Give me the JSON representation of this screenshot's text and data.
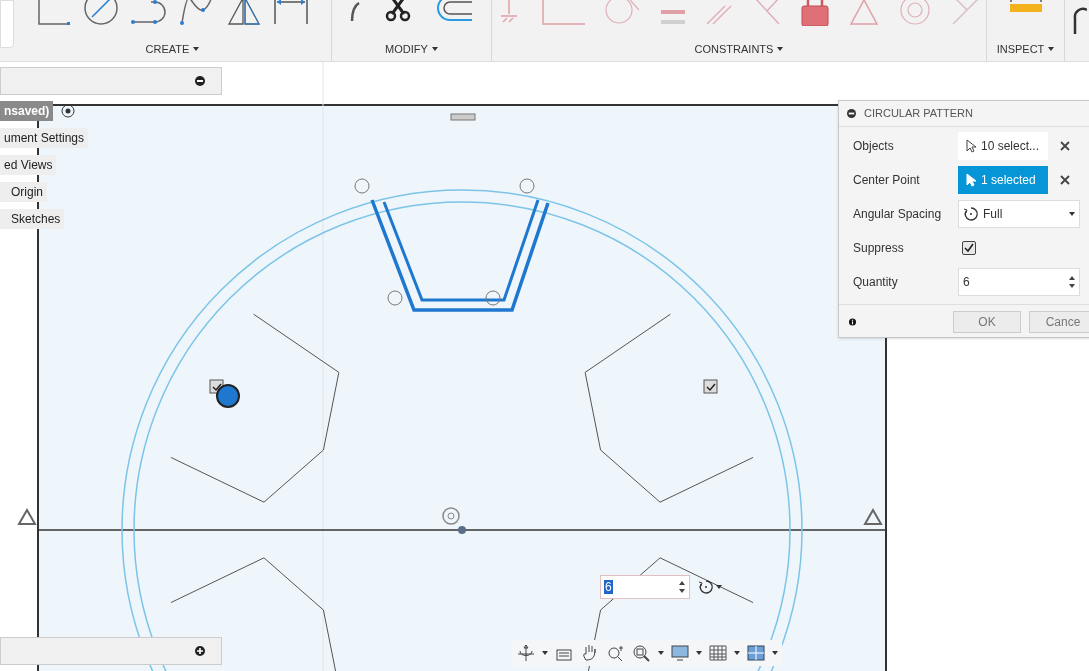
{
  "toolbar": {
    "groups": [
      {
        "label": "CREATE"
      },
      {
        "label": "MODIFY"
      },
      {
        "label": "CONSTRAINTS"
      },
      {
        "label": "INSPECT"
      }
    ]
  },
  "browser": {
    "items": [
      {
        "label": "nsaved)",
        "selected": true
      },
      {
        "label": "ument Settings",
        "selected": false
      },
      {
        "label": "ed Views",
        "selected": false
      },
      {
        "label": "Origin",
        "selected": false
      },
      {
        "label": "Sketches",
        "selected": false
      }
    ]
  },
  "dialog": {
    "title": "CIRCULAR PATTERN",
    "rows": [
      {
        "kind": "selection",
        "label": "Objects",
        "value": "10 select...",
        "active": false
      },
      {
        "kind": "selection",
        "label": "Center Point",
        "value": "1 selected",
        "active": true
      },
      {
        "kind": "dropdown",
        "label": "Angular Spacing",
        "value": "Full"
      },
      {
        "kind": "checkbox",
        "label": "Suppress",
        "checked": true
      },
      {
        "kind": "number",
        "label": "Quantity",
        "value": "6"
      }
    ],
    "buttons": [
      "OK",
      "Cance"
    ]
  },
  "canvas_input": {
    "value": "6"
  }
}
